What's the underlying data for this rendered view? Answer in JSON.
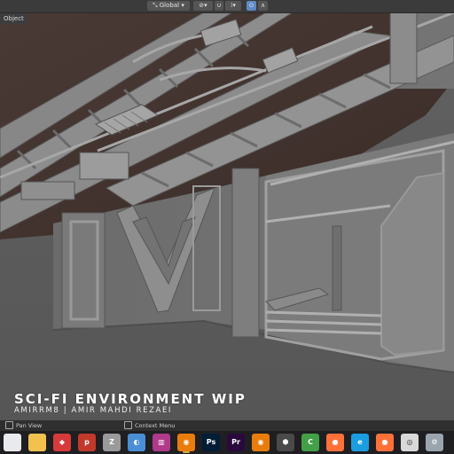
{
  "header": {
    "transform_orientation": "Global",
    "mode_badge": "Object"
  },
  "overlay": {
    "title": "SCI-FI ENVIRONMENT WIP",
    "subtitle": "AMIRRM8 | AMIR MAHDI REZAEI"
  },
  "statusbar": {
    "pan_view": "Pan View",
    "context_menu": "Context Menu"
  },
  "taskbar": {
    "apps": [
      {
        "name": "chrome",
        "color": "#e8eaed",
        "glyph": ""
      },
      {
        "name": "file-explorer",
        "color": "#f2c14e",
        "glyph": ""
      },
      {
        "name": "app-red",
        "color": "#d63a3a",
        "glyph": "◆"
      },
      {
        "name": "wps",
        "color": "#c0392b",
        "glyph": "p"
      },
      {
        "name": "zbrush",
        "color": "#9a9a9a",
        "glyph": "Z"
      },
      {
        "name": "photos",
        "color": "#4a8fd6",
        "glyph": "◐"
      },
      {
        "name": "winrar",
        "color": "#b03a8a",
        "glyph": "▥"
      },
      {
        "name": "blender",
        "color": "#e87d0d",
        "glyph": "◉"
      },
      {
        "name": "photoshop",
        "color": "#001e36",
        "glyph": "Ps"
      },
      {
        "name": "premiere",
        "color": "#2a0a3e",
        "glyph": "Pr"
      },
      {
        "name": "blender-2",
        "color": "#e87d0d",
        "glyph": "◉"
      },
      {
        "name": "unity",
        "color": "#4a4a4a",
        "glyph": "⬢"
      },
      {
        "name": "camtasia",
        "color": "#43a047",
        "glyph": "C"
      },
      {
        "name": "firefox",
        "color": "#ff7139",
        "glyph": "●"
      },
      {
        "name": "edge",
        "color": "#1b9de2",
        "glyph": "e"
      },
      {
        "name": "firefox-2",
        "color": "#ff7139",
        "glyph": "●"
      },
      {
        "name": "media-player",
        "color": "#d9d9d9",
        "glyph": "◎"
      },
      {
        "name": "settings",
        "color": "#9aa4ad",
        "glyph": "⚙"
      }
    ]
  }
}
